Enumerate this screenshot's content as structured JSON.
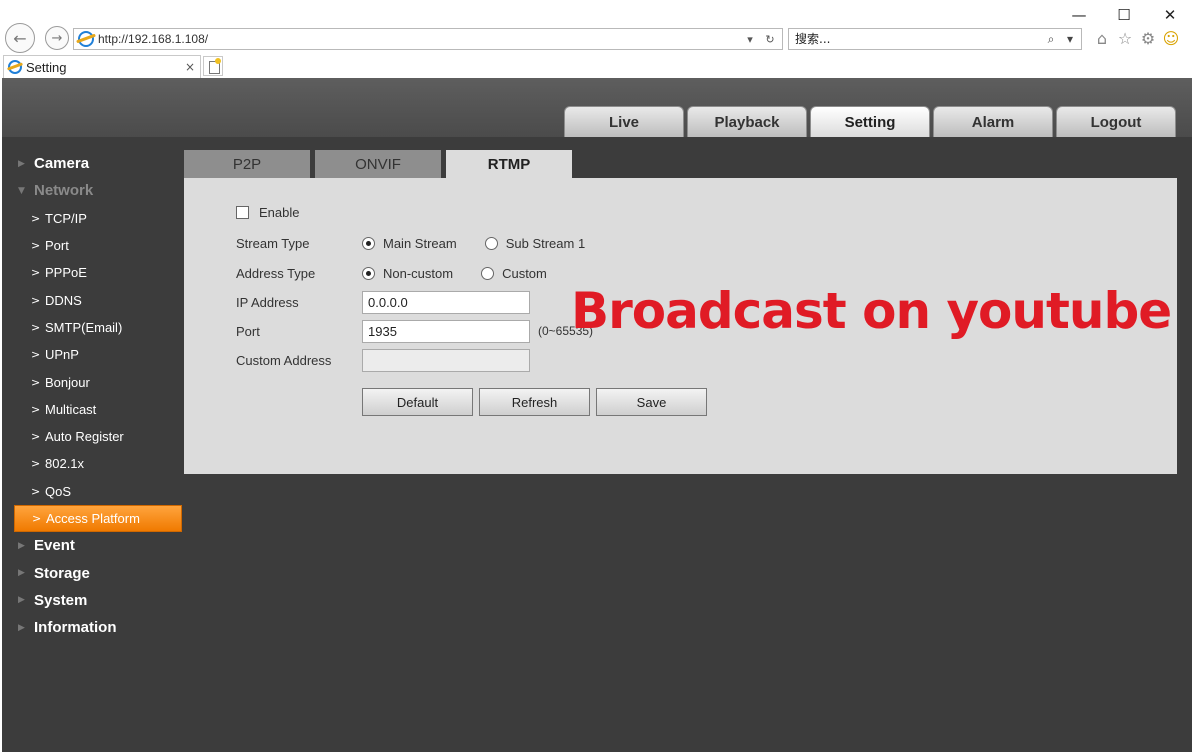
{
  "browser": {
    "window_controls": {
      "minimize": "—",
      "maximize": "☐",
      "close": "✕"
    },
    "nav": {
      "back": "←",
      "forward": "→"
    },
    "address": {
      "url": "http://192.168.1.108/",
      "dropdown_icon": "▾",
      "refresh_icon": "↻"
    },
    "search": {
      "placeholder": "搜索...",
      "search_icon": "⌕",
      "dropdown_icon": "▾"
    },
    "toolbar_icons": {
      "home": "⌂",
      "favorites": "☆",
      "settings": "⚙",
      "feedback": "☺"
    },
    "tab": {
      "title": "Setting",
      "close": "×"
    }
  },
  "app": {
    "top_nav": [
      {
        "label": "Live",
        "active": false
      },
      {
        "label": "Playback",
        "active": false
      },
      {
        "label": "Setting",
        "active": true
      },
      {
        "label": "Alarm",
        "active": false
      },
      {
        "label": "Logout",
        "active": false
      }
    ],
    "sidebar": {
      "camera": "Camera",
      "network": "Network",
      "network_items": [
        "TCP/IP",
        "Port",
        "PPPoE",
        "DDNS",
        "SMTP(Email)",
        "UPnP",
        "Bonjour",
        "Multicast",
        "Auto Register",
        "802.1x",
        "QoS",
        "Access Platform"
      ],
      "event": "Event",
      "storage": "Storage",
      "system": "System",
      "information": "Information",
      "collapsed_arrow": "▶",
      "expanded_arrow": "▼",
      "sub_chevron": ">"
    },
    "sub_tabs": [
      {
        "label": "P2P",
        "active": false
      },
      {
        "label": "ONVIF",
        "active": false
      },
      {
        "label": "RTMP",
        "active": true
      }
    ],
    "form": {
      "enable_label": "Enable",
      "enable_checked": false,
      "stream_type_label": "Stream Type",
      "stream_options": [
        "Main Stream",
        "Sub Stream 1"
      ],
      "stream_selected": "Main Stream",
      "address_type_label": "Address Type",
      "address_options": [
        "Non-custom",
        "Custom"
      ],
      "address_selected": "Non-custom",
      "ip_label": "IP Address",
      "ip_value": "0.0.0.0",
      "port_label": "Port",
      "port_value": "1935",
      "port_hint": "(0~65535)",
      "custom_address_label": "Custom Address",
      "custom_address_value": "",
      "buttons": {
        "default": "Default",
        "refresh": "Refresh",
        "save": "Save"
      }
    },
    "overlay_text": "Broadcast on youtube"
  },
  "colors": {
    "active_menu": "#f07a00",
    "overlay_text": "#e01b25",
    "panel_bg": "#dcdcdc",
    "app_bg": "#3c3c3c"
  }
}
